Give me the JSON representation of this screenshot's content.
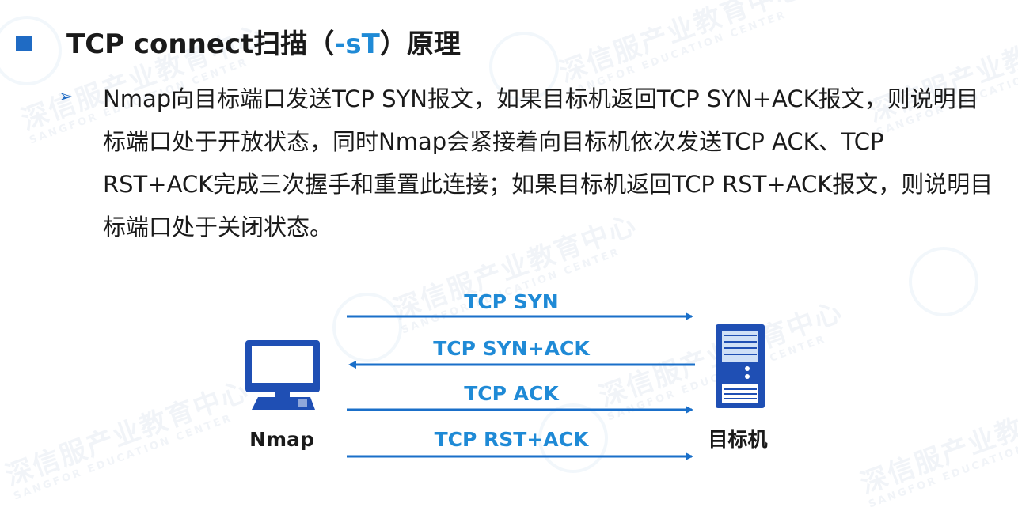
{
  "title": {
    "prefix": "TCP connect扫描（",
    "highlight": "-sT",
    "suffix": "）原理"
  },
  "paragraph": "Nmap向目标端口发送TCP SYN报文，如果目标机返回TCP SYN+ACK报文，则说明目标端口处于开放状态，同时Nmap会紧接着向目标机依次发送TCP ACK、TCP RST+ACK完成三次握手和重置此连接；如果目标机返回TCP RST+ACK报文，则说明目标端口处于关闭状态。",
  "diagram": {
    "left_node": "Nmap",
    "right_node": "目标机",
    "messages": [
      {
        "label": "TCP  SYN",
        "direction": "right"
      },
      {
        "label": "TCP  SYN+ACK",
        "direction": "left"
      },
      {
        "label": "TCP  ACK",
        "direction": "right"
      },
      {
        "label": "TCP  RST+ACK",
        "direction": "right"
      }
    ]
  },
  "watermark": {
    "text": "深信服产业教育中心",
    "sub": "SANGFOR EDUCATION CENTER"
  },
  "colors": {
    "accent": "#1f6bc4",
    "highlight": "#1f8ad6",
    "arrow": "#1a6fc9"
  }
}
